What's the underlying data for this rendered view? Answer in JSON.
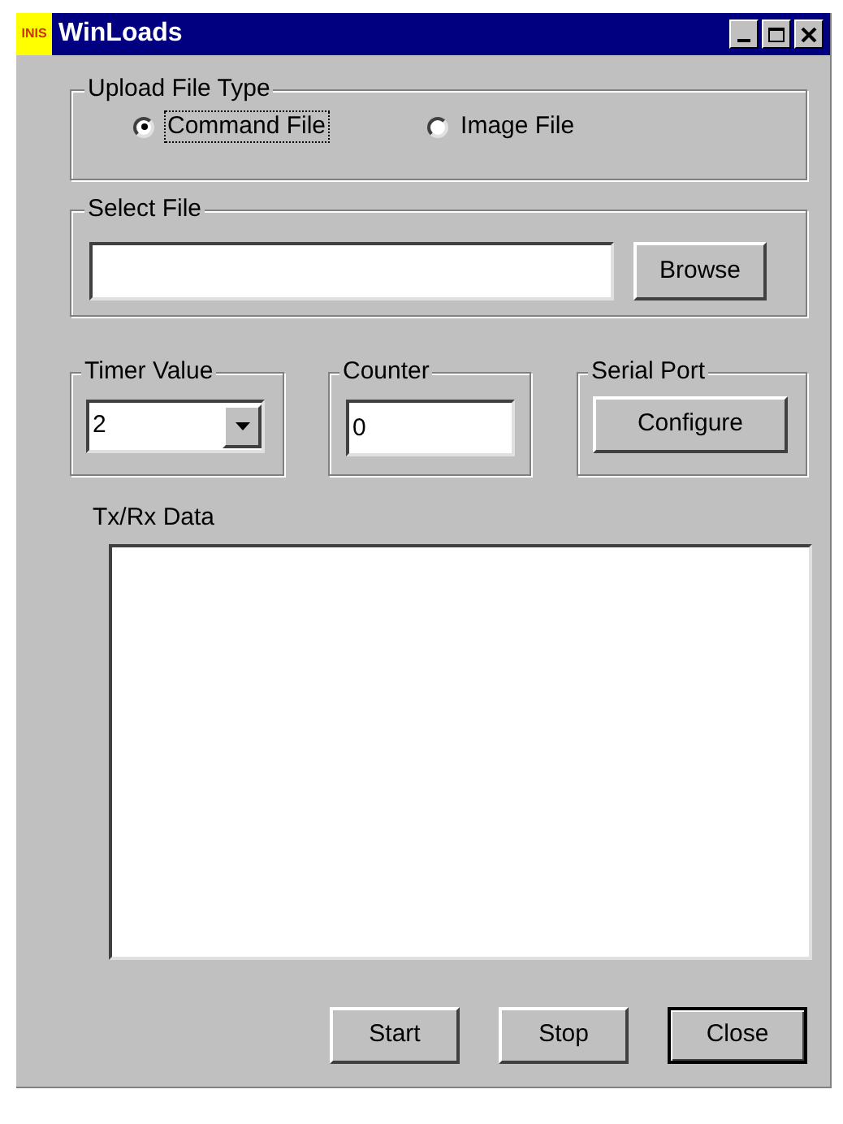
{
  "window": {
    "logo_text": "INIS",
    "title": "WinLoads"
  },
  "upload_file_type": {
    "label": "Upload File Type",
    "options": [
      {
        "label": "Command File",
        "selected": true
      },
      {
        "label": "Image File",
        "selected": false
      }
    ]
  },
  "select_file": {
    "label": "Select File",
    "button": "Browse"
  },
  "timer_value": {
    "label": "Timer Value",
    "value": "2"
  },
  "counter": {
    "label": "Counter",
    "value": "0"
  },
  "serial_port": {
    "label": "Serial Port",
    "button": "Configure"
  },
  "txrx": {
    "label": "Tx/Rx Data"
  },
  "buttons": [
    {
      "label": "Start",
      "default": false
    },
    {
      "label": "Stop",
      "default": false
    },
    {
      "label": "Close",
      "default": true
    }
  ]
}
